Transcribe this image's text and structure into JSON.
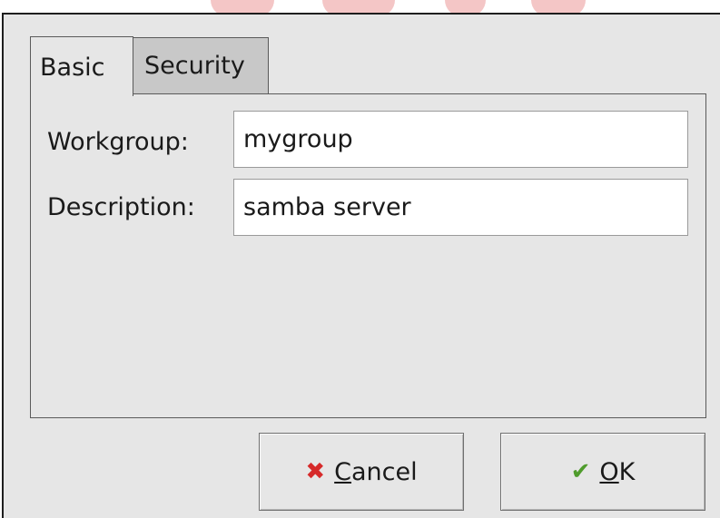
{
  "tabs": [
    {
      "label": "Basic",
      "active": true
    },
    {
      "label": "Security",
      "active": false
    }
  ],
  "fields": {
    "workgroup": {
      "label": "Workgroup:",
      "value": "mygroup"
    },
    "description": {
      "label": "Description:",
      "value": "samba server"
    }
  },
  "buttons": {
    "cancel": {
      "mnemonic": "C",
      "rest": "ancel",
      "icon": "cancel-x-icon"
    },
    "ok": {
      "mnemonic": "O",
      "rest": "K",
      "icon": "checkmark-icon"
    }
  },
  "colors": {
    "dialog_bg": "#e6e6e6",
    "inactive_tab": "#c8c8c8",
    "cancel_icon": "#d62a2a",
    "ok_icon": "#4f9c2c",
    "watermark": "#f4c6c6"
  }
}
